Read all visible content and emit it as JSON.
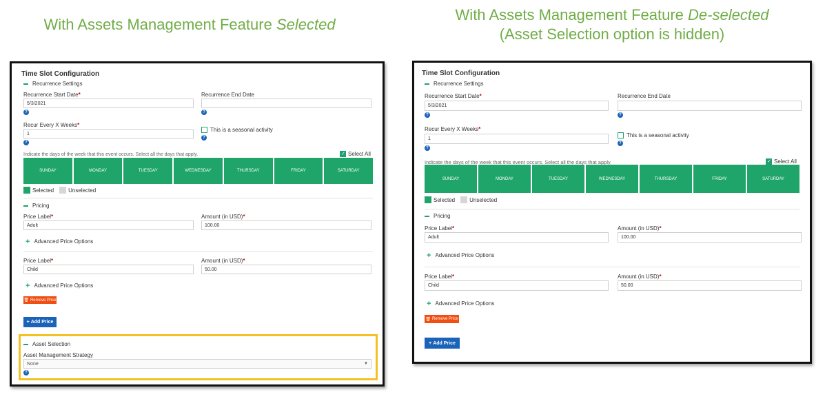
{
  "captions": {
    "left": {
      "line1_prefix": "With Assets Management Feature ",
      "line1_em": "Selected"
    },
    "right": {
      "line1_prefix": "With Assets Management Feature ",
      "line1_em": "De-selected",
      "line2": "(Asset Selection option is hidden)"
    }
  },
  "form": {
    "title": "Time Slot Configuration",
    "recurrence": {
      "section_label": "Recurrence Settings",
      "start_date_label": "Recurrence Start Date",
      "start_date_value": "5/3/2021",
      "end_date_label": "Recurrence End Date",
      "end_date_value": "",
      "recur_label": "Recur Every X Weeks",
      "recur_value": "1",
      "seasonal_label": "This is a seasonal activity",
      "days_instruction": "Indicate the days of the week that this event occurs. Select all the days that apply.",
      "select_all_label": "Select All",
      "days": [
        "SUNDAY",
        "MONDAY",
        "TUESDAY",
        "WEDNESDAY",
        "THURSDAY",
        "FRIDAY",
        "SATURDAY"
      ],
      "legend_selected": "Selected",
      "legend_unselected": "Unselected"
    },
    "pricing": {
      "section_label": "Pricing",
      "price_label": "Price Label",
      "amount_label": "Amount (in USD)",
      "advanced_label": "Advanced Price Options",
      "remove_label": "Remove Price",
      "add_label": "Add Price",
      "prices": [
        {
          "label": "Adult",
          "amount": "100.00"
        },
        {
          "label": "Child",
          "amount": "50.00"
        }
      ]
    },
    "asset": {
      "section_label": "Asset Selection",
      "strategy_label": "Asset Management Strategy",
      "strategy_value": "None"
    }
  },
  "colors": {
    "accent_green": "#1fa56a",
    "caption_green": "#70ad47",
    "highlight": "#f5c020",
    "remove": "#f04e12",
    "add": "#1a63b8"
  }
}
